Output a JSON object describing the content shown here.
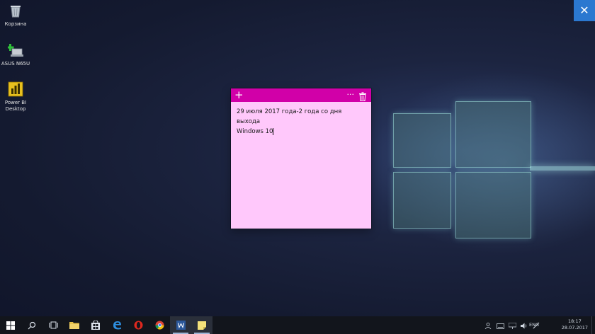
{
  "desktop": {
    "icons": [
      {
        "label": "Корзина"
      },
      {
        "label": "ASUS N65U"
      },
      {
        "label": "Power BI Desktop"
      }
    ]
  },
  "corner_button": {
    "icon": "close-icon",
    "glyph": "✕",
    "color": "#2b78d0"
  },
  "sticky_note": {
    "color": "#ffc8fb",
    "header_color": "#d100a8",
    "add_glyph": "+",
    "more_glyph": "···",
    "lines": [
      "29 июля 2017 года-2 года со дня выхода",
      "Windows 10"
    ]
  },
  "taskbar": {
    "lang": "ENG",
    "time": "18:17",
    "date": "28.07.2017"
  }
}
